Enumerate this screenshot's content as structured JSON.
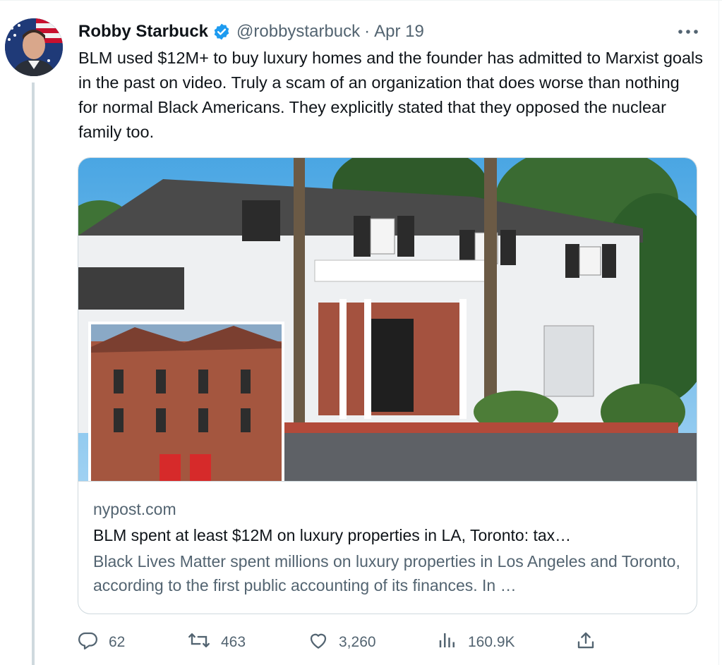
{
  "tweet": {
    "author_name": "Robby Starbuck",
    "handle": "@robbystarbuck",
    "separator": "·",
    "date": "Apr 19",
    "text": "BLM used $12M+ to buy luxury homes and the founder has admitted to Marxist goals in the past on video. Truly a scam of an organization that does worse than nothing for normal Black Americans. They explicitly stated that they opposed the nuclear family too."
  },
  "link_card": {
    "domain": "nypost.com",
    "title": "BLM spent at least $12M on luxury properties in LA, Toronto: tax…",
    "description": "Black Lives Matter spent millions on luxury properties in Los Angeles and Toronto, according to the first public accounting of its finances. In …"
  },
  "actions": {
    "replies": "62",
    "retweets": "463",
    "likes": "3,260",
    "views": "160.9K"
  },
  "icons": {
    "verified": "verified-badge-icon",
    "more": "more-icon",
    "reply": "reply-icon",
    "retweet": "retweet-icon",
    "like": "heart-icon",
    "views": "views-icon",
    "share": "share-icon"
  },
  "colors": {
    "verified_blue": "#1d9bf0",
    "text_primary": "#0f1419",
    "text_secondary": "#536471",
    "border": "#cfd9de"
  }
}
